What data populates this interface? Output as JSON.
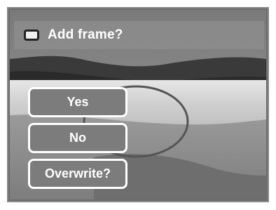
{
  "dialog": {
    "title": "Add frame?",
    "icon": "frame-icon"
  },
  "options": [
    {
      "label": "Yes"
    },
    {
      "label": "No"
    },
    {
      "label": "Overwrite?"
    }
  ],
  "colors": {
    "frame_border": "#8a8a8a",
    "overlay": "#8c8c8c",
    "button_bg": "#7c7c7c",
    "button_border": "#ffffff",
    "text": "#ffffff"
  }
}
